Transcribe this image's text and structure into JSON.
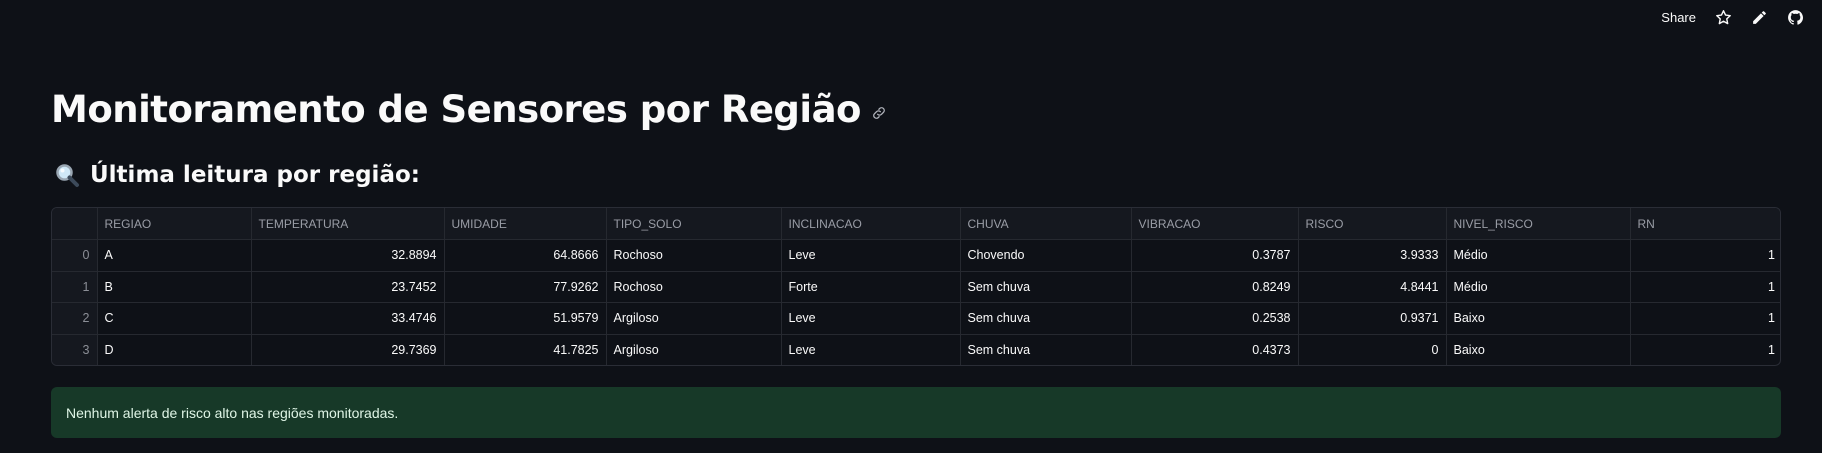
{
  "toolbar": {
    "share_label": "Share"
  },
  "header": {
    "title": "Monitoramento de Sensores por Região",
    "subtitle": "Última leitura por região:"
  },
  "table": {
    "columns": [
      "",
      "REGIAO",
      "TEMPERATURA",
      "UMIDADE",
      "TIPO_SOLO",
      "INCLINACAO",
      "CHUVA",
      "VIBRACAO",
      "RISCO",
      "NIVEL_RISCO",
      "RN"
    ],
    "rows": [
      [
        "0",
        "A",
        "32.8894",
        "64.8666",
        "Rochoso",
        "Leve",
        "Chovendo",
        "0.3787",
        "3.9333",
        "Médio",
        "1"
      ],
      [
        "1",
        "B",
        "23.7452",
        "77.9262",
        "Rochoso",
        "Forte",
        "Sem chuva",
        "0.8249",
        "4.8441",
        "Médio",
        "1"
      ],
      [
        "2",
        "C",
        "33.4746",
        "51.9579",
        "Argiloso",
        "Leve",
        "Sem chuva",
        "0.2538",
        "0.9371",
        "Baixo",
        "1"
      ],
      [
        "3",
        "D",
        "29.7369",
        "41.7825",
        "Argiloso",
        "Leve",
        "Sem chuva",
        "0.4373",
        "0",
        "Baixo",
        "1"
      ]
    ]
  },
  "alert": {
    "message": "Nenhum alerta de risco alto nas regiões monitoradas."
  },
  "colors": {
    "background": "#0e1117",
    "alert_bg": "#173928",
    "alert_text": "#dff5e6"
  },
  "icons": [
    "star-icon",
    "pencil-icon",
    "github-icon",
    "link-icon",
    "magnifier-icon"
  ]
}
